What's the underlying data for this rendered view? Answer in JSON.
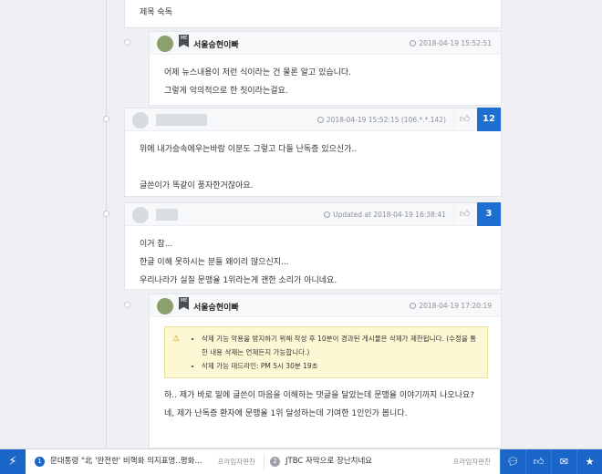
{
  "comments": [
    {
      "body": [
        "제목 숙독"
      ]
    },
    {
      "author": "서울승현이빠",
      "badge": "ME",
      "time": "2018-04-19 15:52:51",
      "body": [
        "어제 뉴스내용이 저런 식이라는 건 물론 알고 있습니다.",
        "그렇게 악의적으로 한 짓이라는걸요."
      ]
    },
    {
      "time": "2018-04-19 15:52:15 (106.*.*.142)",
      "likes": "12",
      "body": [
        "위에 내가승속에우는바람 이분도 그렇고 다들 난독증 있으신가..",
        "",
        "글쓴이가 똑같이 풍자한거잖아요."
      ]
    },
    {
      "time": "Updated at 2018-04-19 16:38:41",
      "likes": "3",
      "body": [
        "이거 참...",
        "한글 이해 못하시는 분들 왜이리 많으신지...",
        "우리나라가 실질 문맹율 1위라는게 괜한 소리가 아니네요."
      ]
    },
    {
      "author": "서울승현이빠",
      "badge": "ME",
      "time": "2018-04-19 17:20:19",
      "notice": [
        "삭제 기능 악용을 방지하기 위해 작성 후 10분이 경과된 게시물은 삭제가 제한됩니다. (수정을 통한 내용 삭제는 언제든지 가능합니다.)",
        "삭제 가능 데드라인: PM 5시 30분 19초"
      ],
      "body": [
        "하.. 제가 바로 밑에 글쓴이 마음을 이해하는 댓글을 달았는데 문맹율 이야기까지 나오나요?",
        "네, 제가 난독증 환자에 문맹율 1위 달성하는데 기여한 1인인가 봅니다."
      ]
    }
  ],
  "bottom_bar": {
    "items": [
      {
        "num": "1",
        "title": "문대통령 \"北 '완전한' 비핵화 의지표명..평화...",
        "source": "프라임자판찬"
      },
      {
        "num": "2",
        "title": "JTBC 자막으로 장난치네요",
        "source": "프라임자판찬"
      }
    ],
    "icons": [
      "bolt-icon",
      "chat-icon",
      "thumbs-up-icon",
      "mail-icon",
      "star-icon"
    ]
  },
  "colors": {
    "accent": "#1e6fd0",
    "notice_bg": "#fdf7d4"
  }
}
